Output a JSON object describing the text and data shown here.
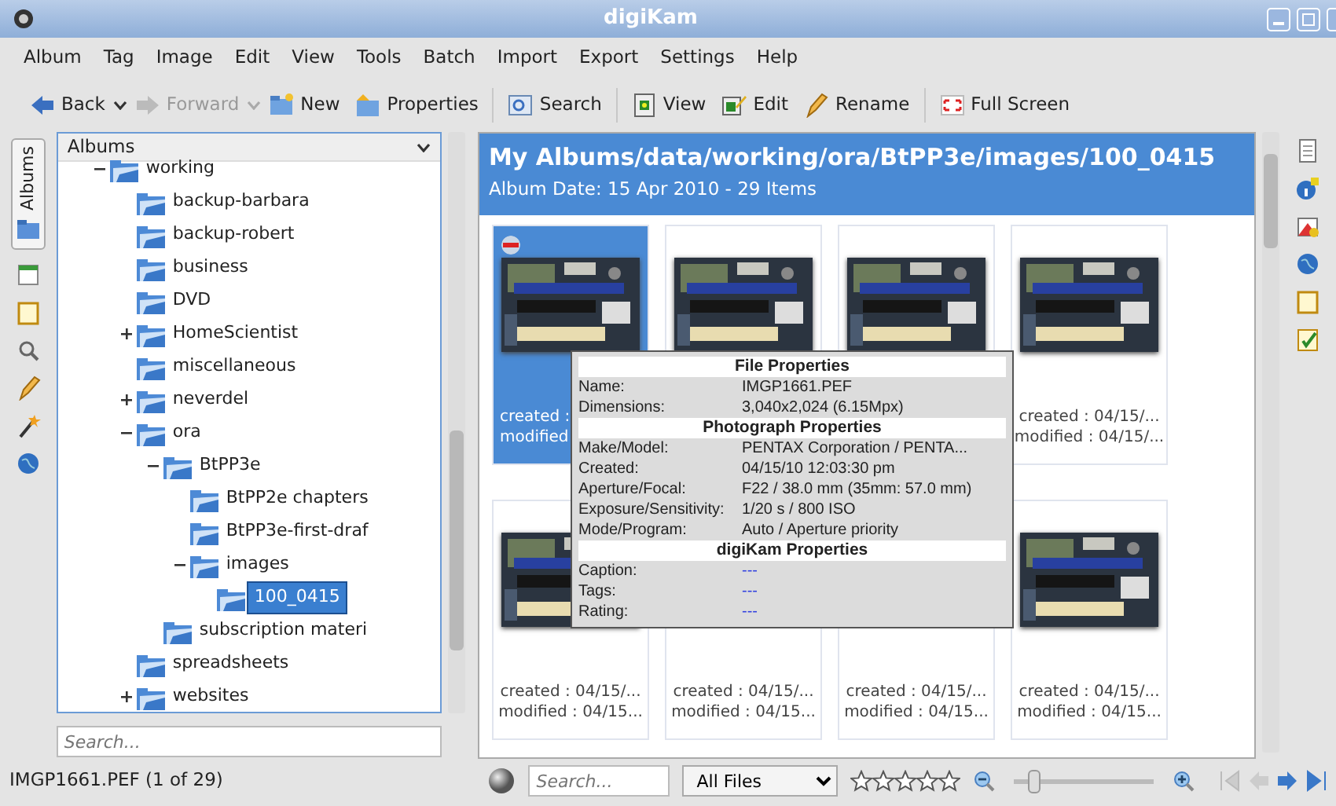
{
  "window": {
    "title": "digiKam"
  },
  "menu": [
    "Album",
    "Tag",
    "Image",
    "Edit",
    "View",
    "Tools",
    "Batch",
    "Import",
    "Export",
    "Settings",
    "Help"
  ],
  "toolbar": [
    {
      "kind": "back",
      "label": "Back",
      "disabled": false,
      "dropdown": true
    },
    {
      "kind": "forward",
      "label": "Forward",
      "disabled": true,
      "dropdown": true
    },
    {
      "kind": "new",
      "label": "New",
      "disabled": false
    },
    {
      "kind": "properties",
      "label": "Properties",
      "disabled": false
    },
    {
      "kind": "search",
      "label": "Search",
      "disabled": false,
      "separator": true
    },
    {
      "kind": "view",
      "label": "View",
      "disabled": false,
      "separator": true
    },
    {
      "kind": "edit",
      "label": "Edit",
      "disabled": false
    },
    {
      "kind": "rename",
      "label": "Rename",
      "disabled": false
    },
    {
      "kind": "fullscreen",
      "label": "Full Screen",
      "disabled": false,
      "separator": true
    }
  ],
  "left_tabs": [
    {
      "kind": "albums",
      "label": "Albums",
      "selected": true
    },
    {
      "kind": "calendar",
      "selected": false
    },
    {
      "kind": "tags",
      "selected": false
    },
    {
      "kind": "search",
      "selected": false
    },
    {
      "kind": "edit",
      "selected": false
    },
    {
      "kind": "wand",
      "selected": false
    },
    {
      "kind": "globe",
      "selected": false
    }
  ],
  "albums_panel": {
    "title": "Albums",
    "search_placeholder": "Search...",
    "tree": [
      {
        "label": "working",
        "expanded": true,
        "selected": false,
        "children": [
          {
            "label": "backup-barbara",
            "selected": false
          },
          {
            "label": "backup-robert",
            "selected": false
          },
          {
            "label": "business",
            "selected": false
          },
          {
            "label": "DVD",
            "selected": false
          },
          {
            "label": "HomeScientist",
            "expanded": false,
            "selected": false
          },
          {
            "label": "miscellaneous",
            "selected": false
          },
          {
            "label": "neverdel",
            "expanded": false,
            "selected": false
          },
          {
            "label": "ora",
            "expanded": true,
            "selected": false,
            "children": [
              {
                "label": "BtPP3e",
                "expanded": true,
                "selected": false,
                "children": [
                  {
                    "label": "BtPP2e chapters",
                    "selected": false
                  },
                  {
                    "label": "BtPP3e-first-draf",
                    "selected": false
                  },
                  {
                    "label": "images",
                    "expanded": true,
                    "selected": false,
                    "children": [
                      {
                        "label": "100_0415",
                        "selected": true
                      }
                    ]
                  }
                ]
              },
              {
                "label": "subscription materi",
                "selected": false
              }
            ]
          },
          {
            "label": "spreadsheets",
            "selected": false
          },
          {
            "label": "websites",
            "expanded": false,
            "selected": false
          }
        ]
      }
    ]
  },
  "content": {
    "title": "My Albums/data/working/ora/BtPP3e/images/100_0415",
    "subtitle": "Album Date: 15 Apr 2010 - 29 Items",
    "thumbnails": [
      {
        "selected": true,
        "rejected": true,
        "kind": "picture",
        "created": "created :",
        "modified": "modified"
      },
      {
        "selected": false,
        "rejected": false,
        "kind": "picture"
      },
      {
        "selected": false,
        "rejected": false,
        "kind": "picture"
      },
      {
        "selected": false,
        "rejected": false,
        "kind": "picture",
        "created": "created : 04/15/...",
        "modified": "modified : 04/15/..."
      },
      {
        "selected": false,
        "rejected": false,
        "kind": "picture",
        "created": "created : 04/15/...",
        "modified": "modified : 04/15..."
      },
      {
        "selected": false,
        "rejected": false,
        "created": "created : 04/15/...",
        "modified": "modified : 04/15..."
      },
      {
        "selected": false,
        "rejected": false,
        "created": "created : 04/15/...",
        "modified": "modified : 04/15..."
      },
      {
        "selected": false,
        "rejected": false,
        "kind": "picture",
        "created": "created : 04/15/...",
        "modified": "modified : 04/15..."
      }
    ],
    "tooltip": [
      {
        "title": "File Properties",
        "rows": [
          {
            "label": "Name:",
            "value": "IMGP1661.PEF"
          },
          {
            "label": "Dimensions:",
            "value": "3,040x2,024 (6.15Mpx)"
          }
        ]
      },
      {
        "title": "Photograph Properties",
        "rows": [
          {
            "label": "Make/Model:",
            "value": "PENTAX Corporation / PENTA..."
          },
          {
            "label": "Created:",
            "value": "04/15/10 12:03:30 pm"
          },
          {
            "label": "Aperture/Focal:",
            "value": "F22 / 38.0 mm (35mm: 57.0 mm)"
          },
          {
            "label": "Exposure/Sensitivity:",
            "value": "1/20 s / 800 ISO"
          },
          {
            "label": "Mode/Program:",
            "value": "Auto / Aperture priority"
          }
        ]
      },
      {
        "title": "digiKam Properties",
        "rows": [
          {
            "label": "Caption:",
            "value": "---",
            "empty": true
          },
          {
            "label": "Tags:",
            "value": "---",
            "empty": true
          },
          {
            "label": "Rating:",
            "value": "---",
            "empty": true
          }
        ]
      }
    ]
  },
  "right_tabs": [
    {
      "kind": "properties",
      "selected": false
    },
    {
      "kind": "info",
      "selected": false
    },
    {
      "kind": "colors",
      "selected": false
    },
    {
      "kind": "globe",
      "selected": false
    },
    {
      "kind": "tags",
      "selected": false
    },
    {
      "kind": "checklist",
      "selected": false
    }
  ],
  "status_bar": {
    "text": "IMGP1661.PEF (1 of 29)",
    "search_placeholder": "Search...",
    "filter": "All Files",
    "stars": 0,
    "zoom": {
      "level": 0.1
    }
  }
}
